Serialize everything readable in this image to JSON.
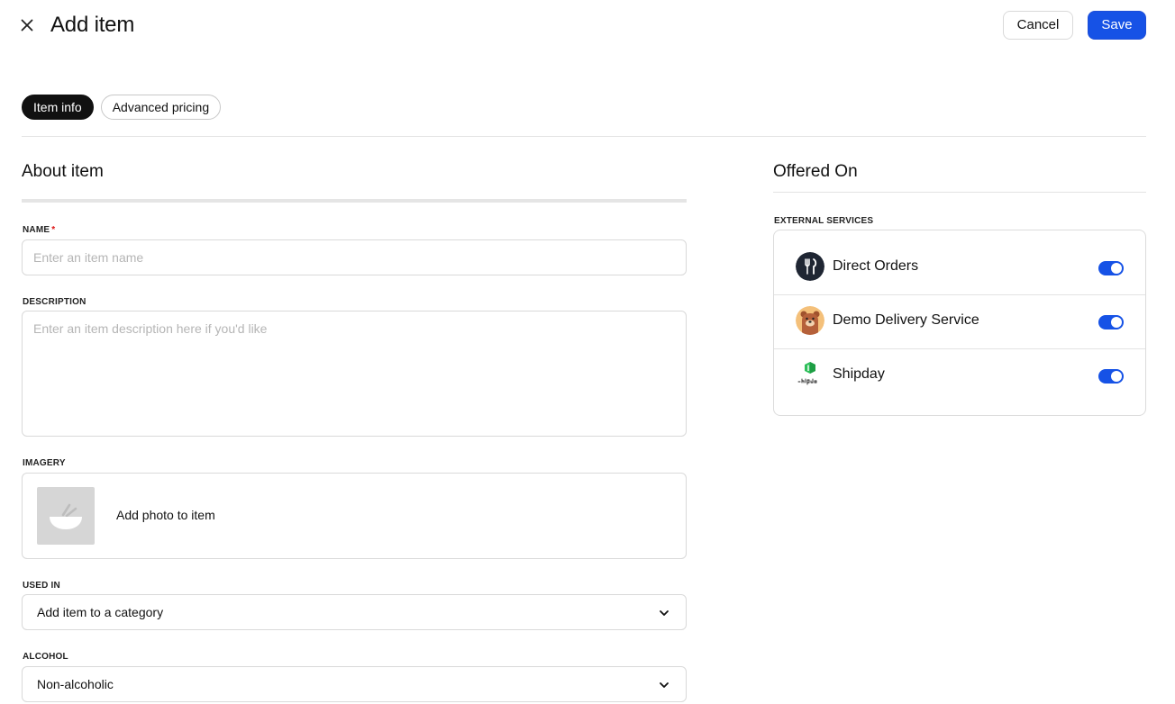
{
  "header": {
    "title": "Add item",
    "cancel_label": "Cancel",
    "save_label": "Save"
  },
  "tabs": [
    {
      "label": "Item info",
      "active": true
    },
    {
      "label": "Advanced pricing",
      "active": false
    }
  ],
  "about": {
    "title": "About item",
    "name": {
      "label": "NAME",
      "required_mark": "*",
      "placeholder": "Enter an item name",
      "value": ""
    },
    "description": {
      "label": "DESCRIPTION",
      "placeholder": "Enter an item description here if you'd like",
      "value": ""
    },
    "imagery": {
      "label": "IMAGERY",
      "add_photo_label": "Add photo to item"
    },
    "used_in": {
      "label": "USED IN",
      "value": "Add item to a category"
    },
    "alcohol": {
      "label": "ALCOHOL",
      "value": "Non-alcoholic"
    }
  },
  "offered_on": {
    "title": "Offered On",
    "external_label": "EXTERNAL SERVICES",
    "services": [
      {
        "name": "Direct Orders",
        "enabled": true,
        "icon": "fork-knife-icon"
      },
      {
        "name": "Demo Delivery Service",
        "enabled": true,
        "icon": "bear-avatar-icon"
      },
      {
        "name": "Shipday",
        "enabled": true,
        "icon": "shipday-logo"
      }
    ]
  },
  "colors": {
    "primary": "#1652e6",
    "required": "#dd1111",
    "border": "#d9d9d9"
  }
}
